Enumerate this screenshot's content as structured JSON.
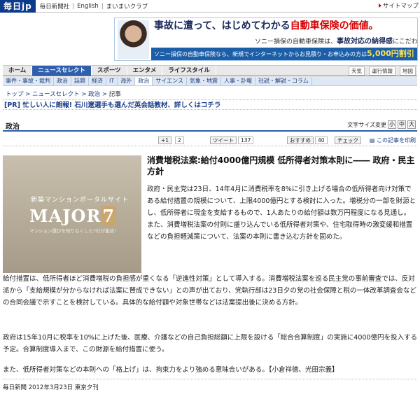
{
  "top": {
    "logo": "毎日jp",
    "links": [
      "毎日新聞社",
      "English",
      "まいまいクラブ"
    ],
    "sitemap": "サイトマップ"
  },
  "ad": {
    "headline_a": "事故に遭って、はじめてわかる",
    "headline_b": "自動車保険の価値。",
    "sub_a": "ソニー損保の自動車保険は、",
    "sub_b": "事故対応の納得感",
    "sub_c": "にこだわります。",
    "strip_a": "ソニー損保の自動車保険なら、新規でインターネットからお見積り・お申込みの方は",
    "strip_b": "5,000円割引"
  },
  "nav": {
    "tabs": [
      "ホーム",
      "ニュースセレクト",
      "スポーツ",
      "エンタメ",
      "ライフスタイル"
    ],
    "tools": [
      "天気",
      "運行情報",
      "地図"
    ]
  },
  "subnav": [
    "事件・事故・裁判",
    "政治",
    "話題",
    "経済",
    "IT",
    "海外",
    "政治",
    "サイエンス",
    "気象・地震",
    "人事・訃報",
    "社説・解説・コラム"
  ],
  "breadcrumb": {
    "items": [
      "トップ",
      "ニュースセレクト",
      "政治"
    ],
    "current": "記事"
  },
  "pr": "[PR] 忙しい人に朗報! 石川遼選手も選んだ英会話教材、詳しくはコチラ",
  "section": {
    "title": "政治",
    "font_size_label": "文字サイズ変更",
    "size_buttons": [
      "小",
      "中",
      "大"
    ]
  },
  "social": {
    "gplus": "+1",
    "gplus_count": "2",
    "tweet": "ツイート",
    "tweet_count": "137",
    "recommend": "おすすめ",
    "recommend_count": "40",
    "check": "チェック",
    "print": "この記事を印刷"
  },
  "photo": {
    "line1": "新築マンションポータルサイト",
    "brand": "MAJOR",
    "brand_num": "7",
    "line3": "マンション選びを知りなくした7社が集結!"
  },
  "article": {
    "headline": "消費増税法案:給付4000億円規模 低所得者対策本則に―― 政府・民主方針",
    "p1": "政府・民主党は23日、14年4月に消費税率を8%に引き上げる場合の低所得者向け対策である給付措置の規模について、上限4000億円とする検討に入った。増税分の一部を財源とし、低所得者に現金を支給するもので、1人あたりの給付額は数万円程度になる見通し。また、消費増税法案の付則に盛り込んでいる低所得者対策や、住宅取得時の激変緩和措置などの負担軽減策について、法案の本則に書き込む方針を固めた。",
    "p2": "給付措置は、低所得者ほど消費増税の負担感が重くなる「逆進性対策」として導入する。消費増税法案を巡る民主党の事前審査では、反対派から「支給規模が分からなければ法案に賛成できない」との声が出ており、党執行部は23日夕の党の社会保障と税の一体改革調査会などの合同会議で示すことを検討している。具体的な給付額や対象世帯などは法案提出後に決める方針。",
    "p3": "政府は15年10月に税率を10%に上げた後、医療、介護などの自己負担総額に上限を設ける「総合合算制度」の実施に4000億円を投入する予定。合算制度導入まで、この財源を給付措置に使う。",
    "p4": "また、低所得者対策などの本則への「格上げ」は、拘束力をより強める意味合いがある。【小倉祥徳、光田宗義】",
    "byline": "毎日新聞 2012年3月23日 東京夕刊"
  }
}
